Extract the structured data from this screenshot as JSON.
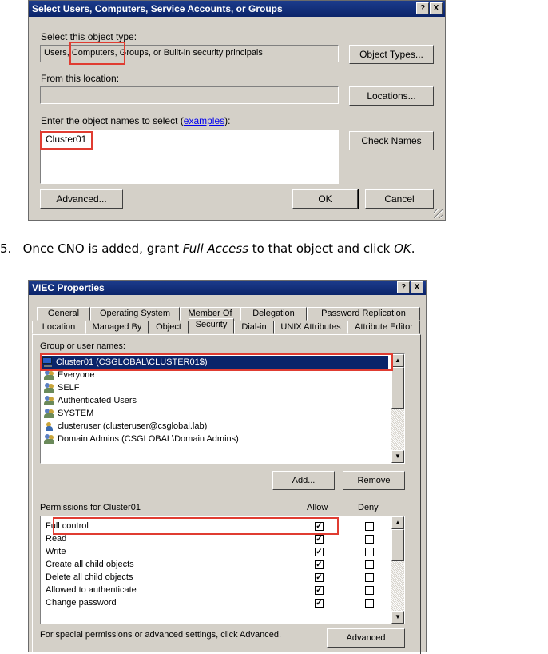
{
  "dialog1": {
    "title": "Select Users, Computers, Service Accounts, or Groups",
    "help_btn": "?",
    "close_btn": "X",
    "object_type_label": "Select this object type:",
    "object_type_value_pre": "Users",
    "object_type_value_mid": ", Computers,",
    "object_type_value_post": " Groups, or Built-in security principals",
    "object_types_btn": "Object Types...",
    "location_label": "From this location:",
    "location_value": "",
    "locations_btn": "Locations...",
    "names_label_pre": "Enter the object names to select (",
    "names_label_link": "examples",
    "names_label_post": "):",
    "names_value": "Cluster01",
    "check_names_btn": "Check Names",
    "advanced_btn": "Advanced...",
    "ok_btn": "OK",
    "cancel_btn": "Cancel"
  },
  "step": {
    "number": "5.",
    "text_pre": "Once CNO is added, grant ",
    "text_em1": "Full Access",
    "text_mid": " to that object and click ",
    "text_em2": "OK",
    "text_post": "."
  },
  "dialog2": {
    "title": "VIEC Properties",
    "help_btn": "?",
    "close_btn": "X",
    "tabs_row1": [
      "General",
      "Operating System",
      "Member Of",
      "Delegation",
      "Password Replication"
    ],
    "tabs_row2": [
      "Location",
      "Managed By",
      "Object",
      "Security",
      "Dial-in",
      "UNIX Attributes",
      "Attribute Editor"
    ],
    "active_tab": "Security",
    "group_label": "Group or user names:",
    "groups": [
      {
        "name": "Cluster01 (CSGLOBAL\\CLUSTER01$)",
        "icon": "computer-icon",
        "selected": true
      },
      {
        "name": "Everyone",
        "icon": "group-icon"
      },
      {
        "name": "SELF",
        "icon": "group-icon"
      },
      {
        "name": "Authenticated Users",
        "icon": "group-icon"
      },
      {
        "name": "SYSTEM",
        "icon": "group-icon"
      },
      {
        "name": "clusteruser (clusteruser@csglobal.lab)",
        "icon": "user-icon"
      },
      {
        "name": "Domain Admins (CSGLOBAL\\Domain Admins)",
        "icon": "group-icon"
      }
    ],
    "add_btn": "Add...",
    "remove_btn": "Remove",
    "perm_label": "Permissions for Cluster01",
    "allow_header": "Allow",
    "deny_header": "Deny",
    "permissions": [
      {
        "name": "Full control",
        "allow": true,
        "deny": false
      },
      {
        "name": "Read",
        "allow": true,
        "deny": false
      },
      {
        "name": "Write",
        "allow": true,
        "deny": false
      },
      {
        "name": "Create all child objects",
        "allow": true,
        "deny": false
      },
      {
        "name": "Delete all child objects",
        "allow": true,
        "deny": false
      },
      {
        "name": "Allowed to authenticate",
        "allow": true,
        "deny": false
      },
      {
        "name": "Change password",
        "allow": true,
        "deny": false
      }
    ],
    "special_text": "For special permissions or advanced settings, click Advanced.",
    "advanced_btn": "Advanced"
  },
  "colors": {
    "highlight": "#e03c31",
    "titlebar": "#0b246a",
    "selection": "#0a246a"
  }
}
